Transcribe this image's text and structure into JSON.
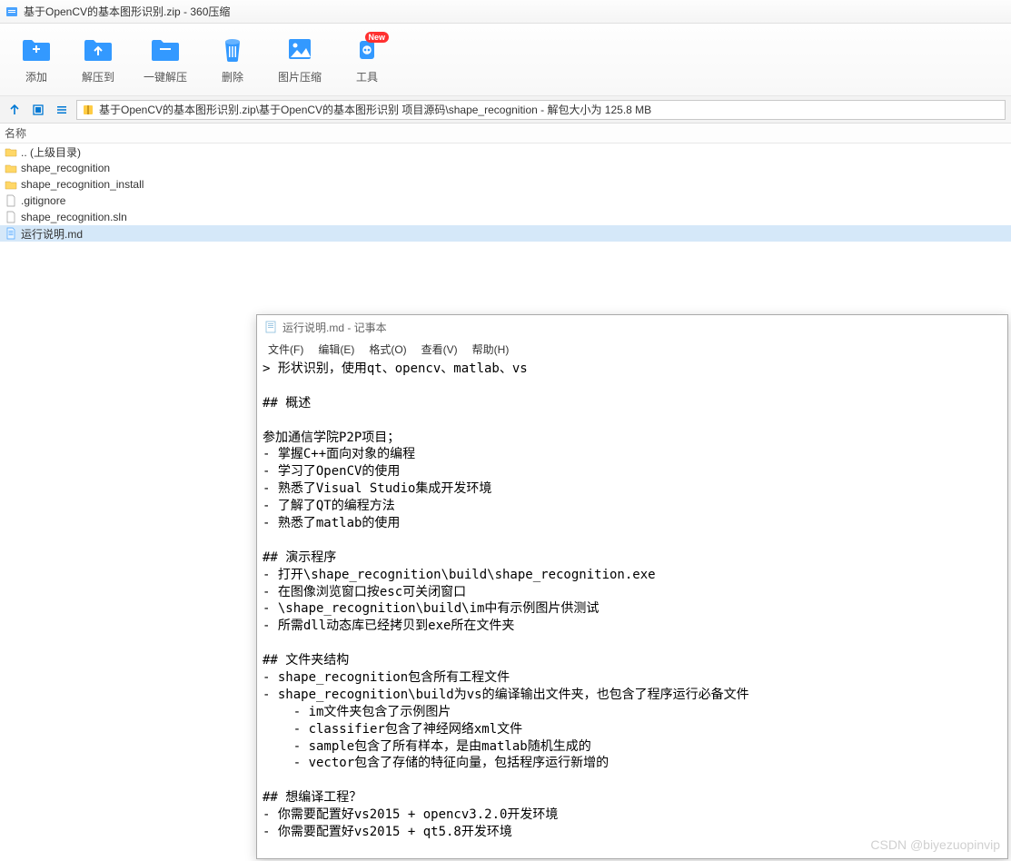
{
  "title": "基于OpenCV的基本图形识别.zip - 360压缩",
  "toolbar": [
    {
      "label": "添加",
      "icon": "add"
    },
    {
      "label": "解压到",
      "icon": "extract"
    },
    {
      "label": "一键解压",
      "icon": "oneclick"
    },
    {
      "label": "删除",
      "icon": "delete"
    },
    {
      "label": "图片压缩",
      "icon": "image"
    },
    {
      "label": "工具",
      "icon": "tools",
      "badge": "New"
    }
  ],
  "path": "基于OpenCV的基本图形识别.zip\\基于OpenCV的基本图形识别 项目源码\\shape_recognition - 解包大小为 125.8 MB",
  "column_name": "名称",
  "files": [
    {
      "name": ".. (上级目录)",
      "type": "up"
    },
    {
      "name": "shape_recognition",
      "type": "folder"
    },
    {
      "name": "shape_recognition_install",
      "type": "folder"
    },
    {
      "name": ".gitignore",
      "type": "file"
    },
    {
      "name": "shape_recognition.sln",
      "type": "file"
    },
    {
      "name": "运行说明.md",
      "type": "md",
      "selected": true
    }
  ],
  "notepad": {
    "title": "运行说明.md - 记事本",
    "menu": [
      "文件(F)",
      "编辑(E)",
      "格式(O)",
      "查看(V)",
      "帮助(H)"
    ],
    "content": "> 形状识别，使用qt、opencv、matlab、vs\n\n## 概述\n\n参加通信学院P2P项目；\n- 掌握C++面向对象的编程\n- 学习了OpenCV的使用\n- 熟悉了Visual Studio集成开发环境\n- 了解了QT的编程方法\n- 熟悉了matlab的使用\n\n## 演示程序\n- 打开\\shape_recognition\\build\\shape_recognition.exe\n- 在图像浏览窗口按esc可关闭窗口\n- \\shape_recognition\\build\\im中有示例图片供测试\n- 所需dll动态库已经拷贝到exe所在文件夹\n\n## 文件夹结构\n- shape_recognition包含所有工程文件\n- shape_recognition\\build为vs的编译输出文件夹，也包含了程序运行必备文件\n    - im文件夹包含了示例图片\n    - classifier包含了神经网络xml文件\n    - sample包含了所有样本，是由matlab随机生成的\n    - vector包含了存储的特征向量，包括程序运行新增的\n\n## 想编译工程？\n- 你需要配置好vs2015 + opencv3.2.0开发环境\n- 你需要配置好vs2015 + qt5.8开发环境"
  },
  "watermark": "CSDN @biyezuopinvip"
}
